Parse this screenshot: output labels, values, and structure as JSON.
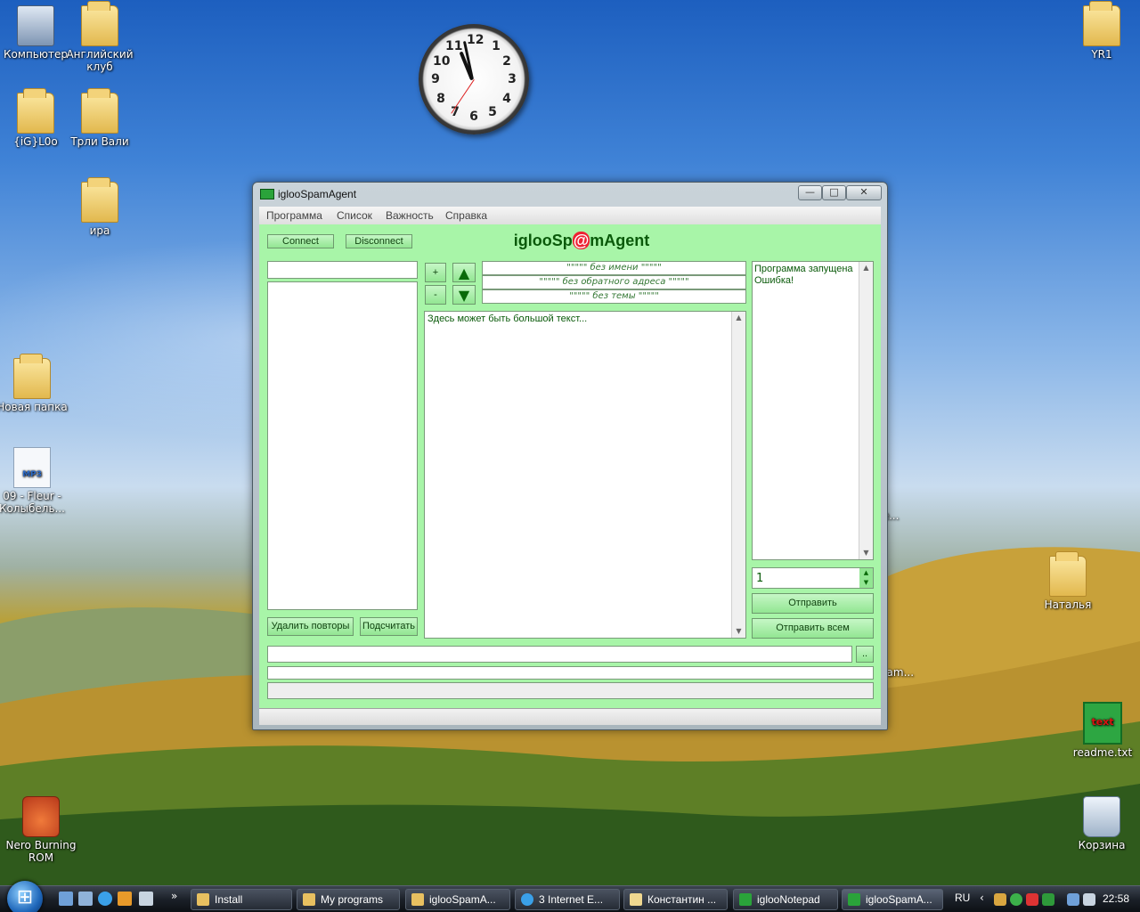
{
  "desktop": {
    "icons": [
      {
        "label": "Компьютер",
        "kind": "pc"
      },
      {
        "label": "Английский клуб",
        "kind": "folder"
      },
      {
        "label": "{iG}L0o",
        "kind": "folder"
      },
      {
        "label": "Трли Вали",
        "kind": "folder"
      },
      {
        "label": "ира",
        "kind": "folder"
      },
      {
        "label": "Новая папка",
        "kind": "folder"
      },
      {
        "label": "09 - Fleur - Колыбель...",
        "kind": "mp3"
      },
      {
        "label": "Nero Burning ROM",
        "kind": "app"
      },
      {
        "label": "YR1",
        "kind": "folder"
      },
      {
        "label": "Наталья",
        "kind": "folder"
      },
      {
        "label": "readme.txt",
        "kind": "text"
      },
      {
        "label": "Корзина",
        "kind": "recycle-bin"
      }
    ],
    "mp3_badge": "MP3",
    "txt_badge": "text",
    "partial_labels": [
      "e...",
      "pam..."
    ]
  },
  "clock": {
    "numerals": [
      "12",
      "1",
      "2",
      "3",
      "4",
      "5",
      "6",
      "7",
      "8",
      "9",
      "10",
      "11"
    ]
  },
  "window": {
    "title": "iglooSpamAgent",
    "controls": {
      "minimize": "—",
      "maximize": "□",
      "close": "✕"
    },
    "menu": [
      "Программа",
      "Список",
      "Важность",
      "Справка"
    ],
    "connect_label": "Connect",
    "disconnect_label": "Disconnect",
    "banner": {
      "before": "iglooSp",
      "at": "@",
      "after": "mAgent"
    },
    "plus_label": "+",
    "minus_label": "-",
    "up_label": "▲",
    "down_label": "▼",
    "header_rows": [
      "\"\"\"\"\" без имени \"\"\"\"\"",
      "\"\"\"\"\" без обратного адреса \"\"\"\"\"",
      "\"\"\"\"\" без темы \"\"\"\"\""
    ],
    "message_text": "Здесь может быть большой текст...",
    "log": [
      "Программа запущена",
      "Ошибка!"
    ],
    "count_value": "1",
    "send_label": "Отправить",
    "send_all_label": "Отправить всем",
    "remove_dupes_label": "Удалить повторы",
    "count_label": "Подсчитать",
    "browse_label": ".."
  },
  "taskbar": {
    "tasks": [
      "Install",
      "My programs",
      "iglooSpamA...",
      "3 Internet E...",
      "Константин ...",
      "iglooNotepad",
      "iglooSpamA..."
    ],
    "lang": "RU",
    "time": "22:58",
    "overflow": "»"
  }
}
